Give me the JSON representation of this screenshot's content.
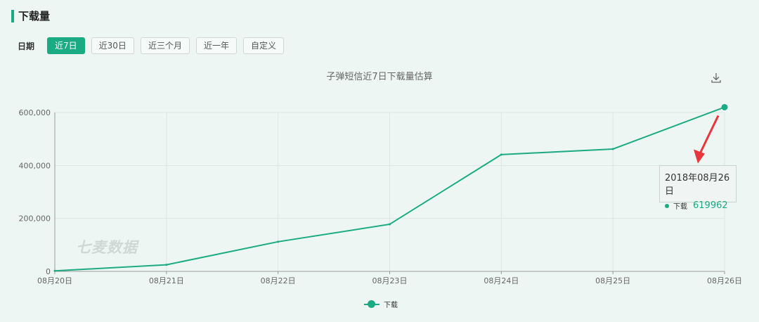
{
  "header": {
    "title": "下载量"
  },
  "filters": {
    "label": "日期",
    "buttons": [
      "近7日",
      "近30日",
      "近三个月",
      "近一年",
      "自定义"
    ],
    "active": 0
  },
  "chart_data": {
    "type": "line",
    "title": "子弹短信近7日下载量估算",
    "categories": [
      "08月20日",
      "08月21日",
      "08月22日",
      "08月23日",
      "08月24日",
      "08月25日",
      "08月26日"
    ],
    "series": [
      {
        "name": "下载",
        "values": [
          2000,
          25000,
          112000,
          178000,
          441000,
          462000,
          619962
        ],
        "color": "#1aab82"
      }
    ],
    "ylim": [
      0,
      600000
    ],
    "yticks": [
      "0",
      "200,000",
      "400,000",
      "600,000"
    ],
    "grid": true,
    "legend": "bottom"
  },
  "tooltip": {
    "date": "2018年08月26日",
    "series_name": "下载",
    "value": "619962"
  },
  "watermark": "七麦数据",
  "colors": {
    "accent": "#1aab82",
    "annotation_arrow": "#e8363c"
  },
  "icons": {
    "download": "download-icon"
  }
}
